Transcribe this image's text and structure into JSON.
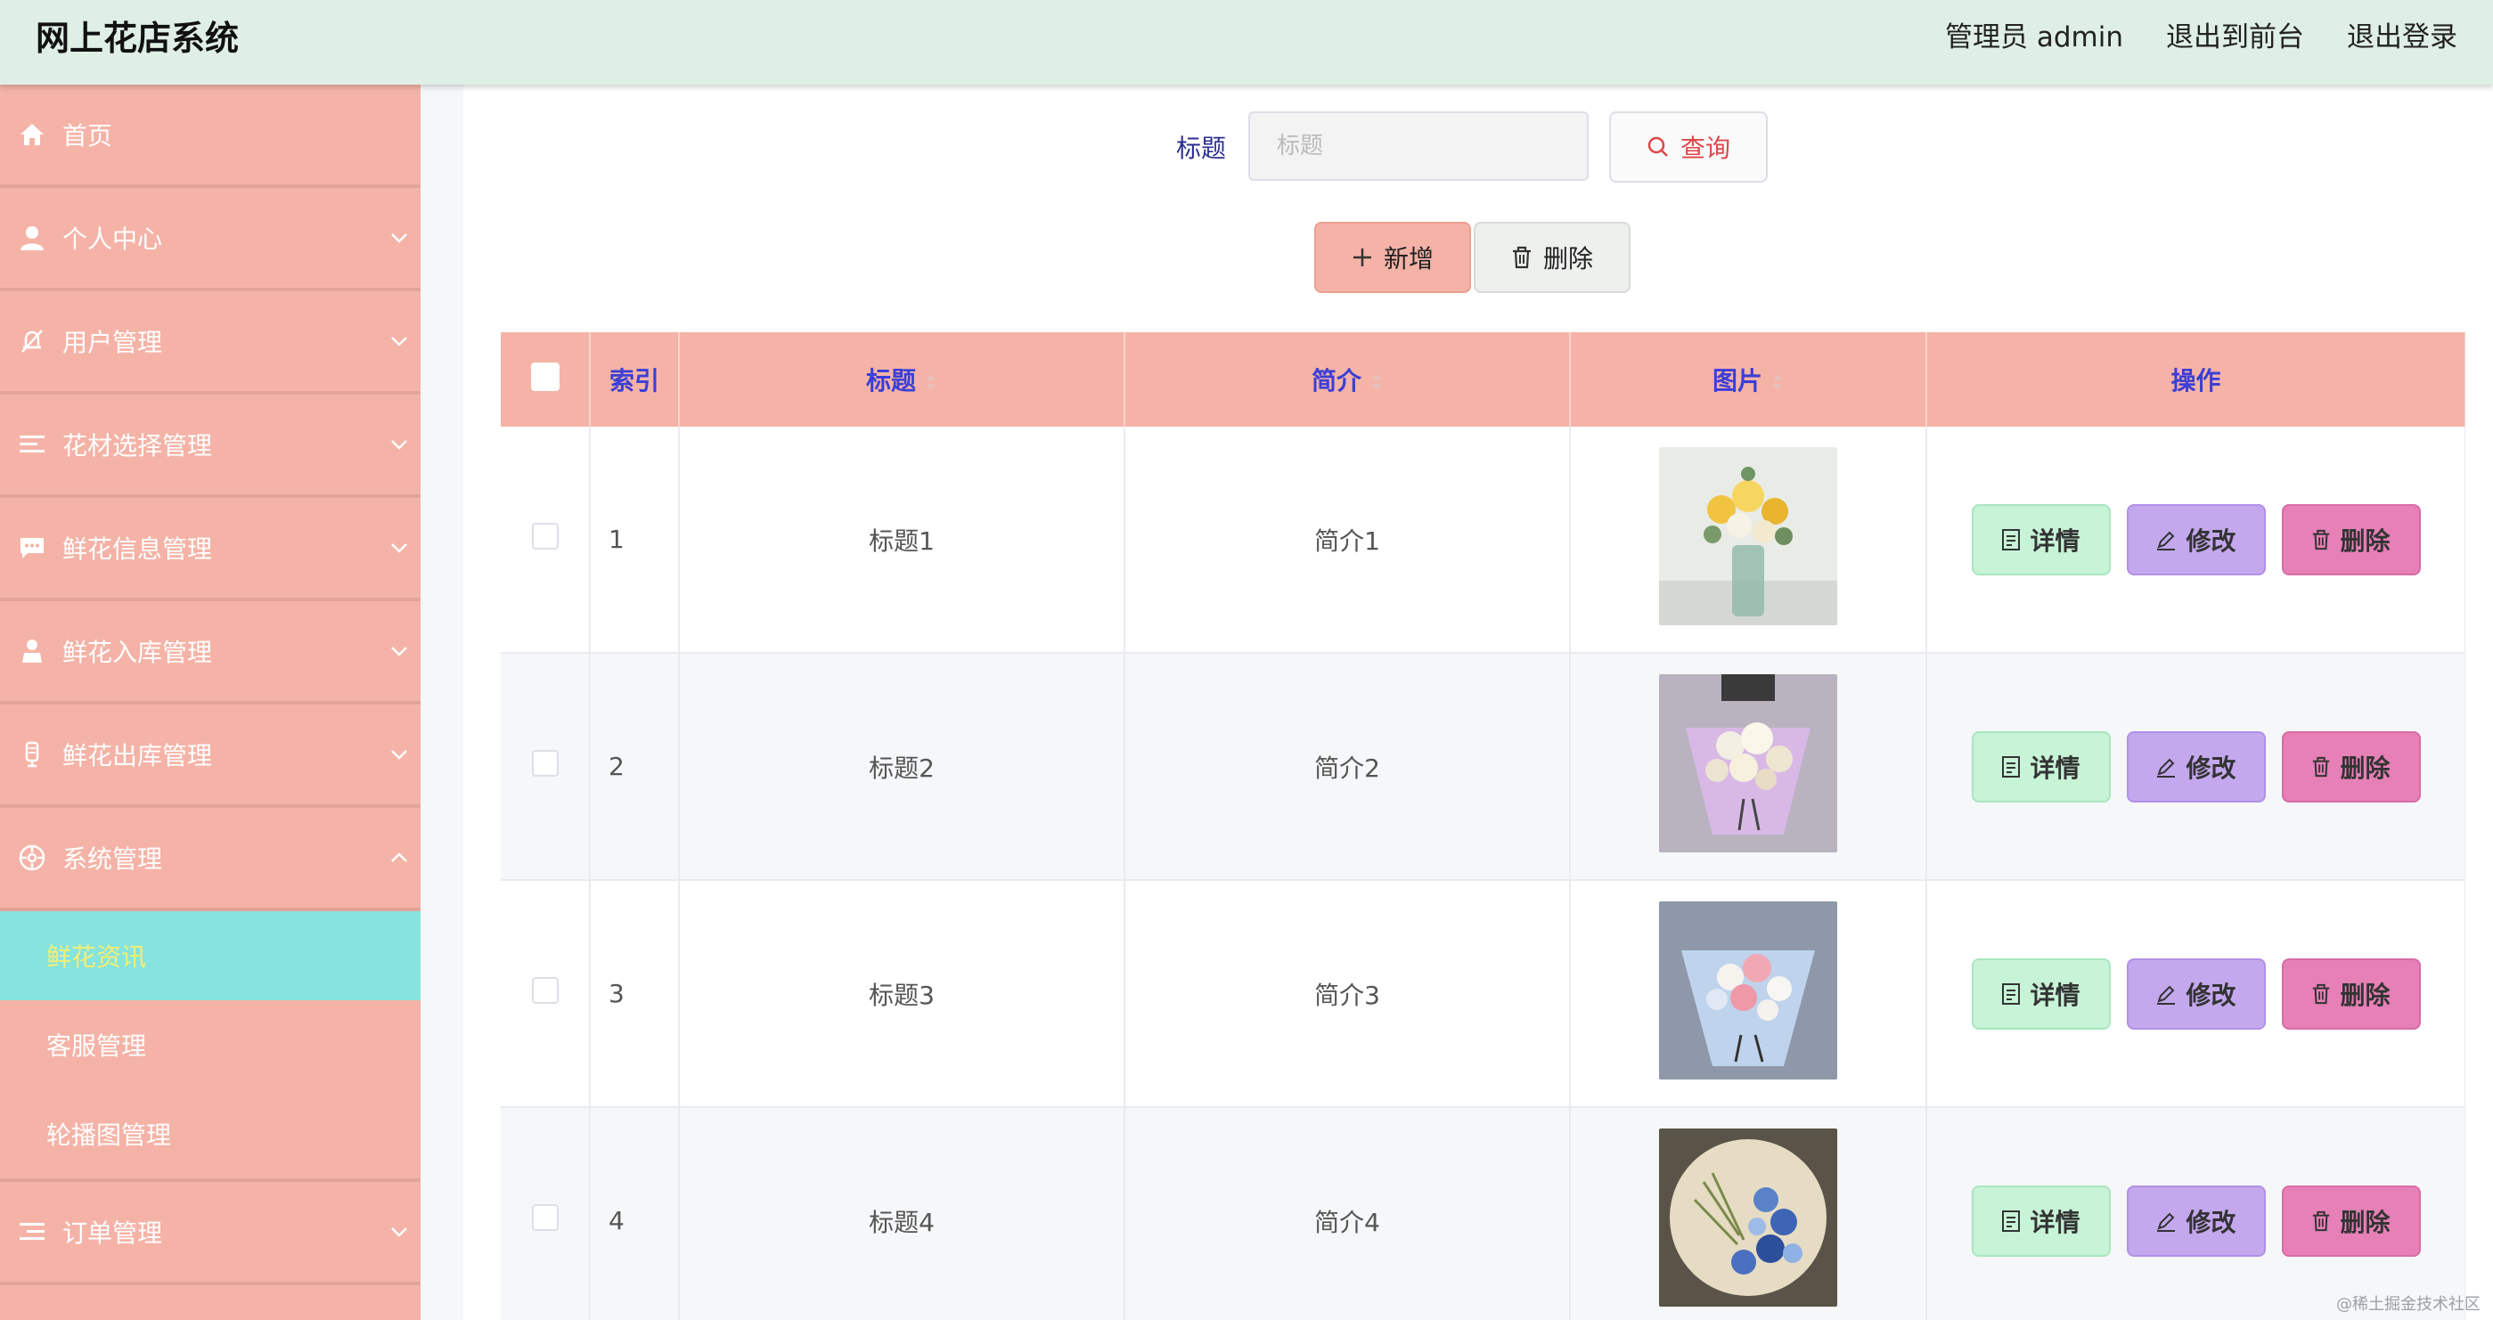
{
  "header": {
    "title": "网上花店系统",
    "links": [
      "管理员 admin",
      "退出到前台",
      "退出登录"
    ]
  },
  "sidebar": {
    "items": [
      {
        "label": "首页",
        "icon": "home-icon"
      },
      {
        "label": "个人中心",
        "icon": "user-icon"
      },
      {
        "label": "用户管理",
        "icon": "bell-off-icon"
      },
      {
        "label": "花材选择管理",
        "icon": "list-icon"
      },
      {
        "label": "鲜花信息管理",
        "icon": "chat-icon"
      },
      {
        "label": "鲜花入库管理",
        "icon": "person-icon"
      },
      {
        "label": "鲜花出库管理",
        "icon": "mic-icon"
      },
      {
        "label": "系统管理",
        "icon": "gear-icon"
      }
    ],
    "sub_items": [
      "鲜花资讯",
      "客服管理",
      "轮播图管理"
    ],
    "last_item": {
      "label": "订单管理",
      "icon": "list-icon"
    }
  },
  "search": {
    "label": "标题",
    "placeholder": "标题",
    "query_label": "查询"
  },
  "actions": {
    "add_label": "新增",
    "delete_label": "删除"
  },
  "table": {
    "headers": [
      "索引",
      "标题",
      "简介",
      "图片",
      "操作"
    ],
    "ops": {
      "detail": "详情",
      "edit": "修改",
      "delete": "删除"
    },
    "rows": [
      {
        "index": "1",
        "title": "标题1",
        "intro": "简介1"
      },
      {
        "index": "2",
        "title": "标题2",
        "intro": "简介2"
      },
      {
        "index": "3",
        "title": "标题3",
        "intro": "简介3"
      },
      {
        "index": "4",
        "title": "标题4",
        "intro": "简介4"
      }
    ]
  },
  "watermark": "@稀土掘金技术社区",
  "colors": {
    "header_bg": "#dfefe6",
    "sidebar_bg": "#f5b3a7",
    "active_bg": "#86e3dd",
    "active_text": "#f3ef75",
    "header_text": "#3b3fd6"
  }
}
